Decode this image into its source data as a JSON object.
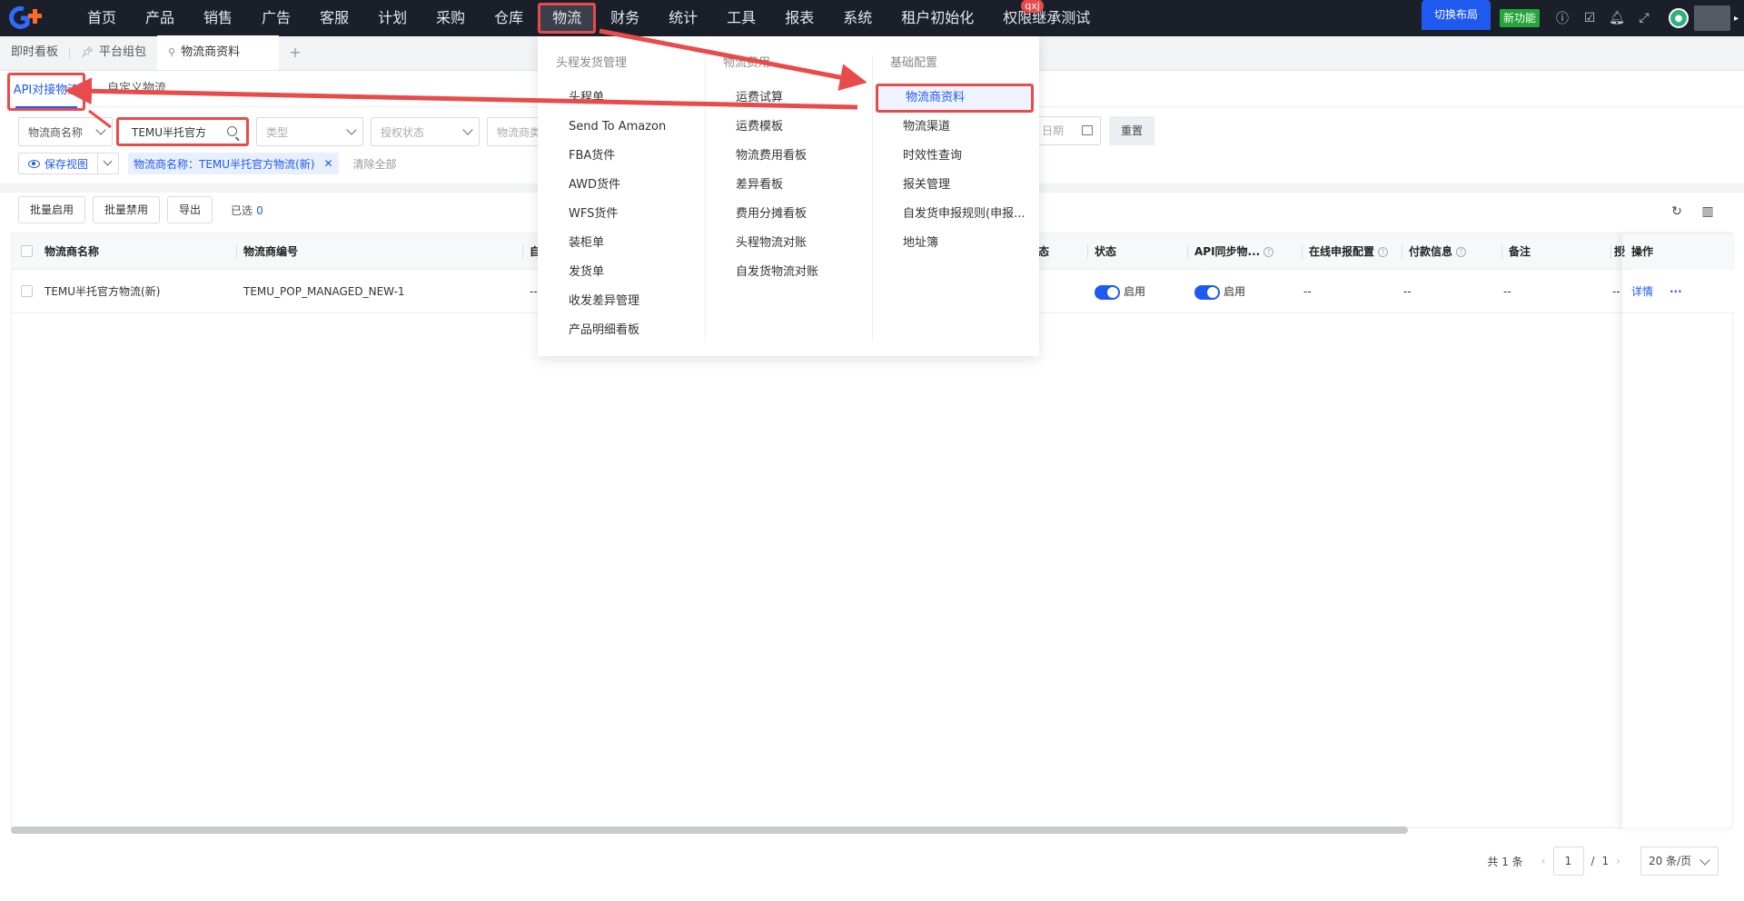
{
  "topnav": {
    "items": [
      "首页",
      "产品",
      "销售",
      "广告",
      "客服",
      "计划",
      "采购",
      "仓库",
      "物流",
      "财务",
      "统计",
      "工具",
      "报表",
      "系统",
      "租户初始化",
      "权限继承测试"
    ],
    "active_index": 8,
    "badge": "qxj",
    "switch_layout": "切换布局",
    "new_feature": "新功能"
  },
  "tabs": {
    "items": [
      "即时看板",
      "平台组包",
      "物流商资料"
    ],
    "add": "+"
  },
  "subtabs": {
    "api": "API对接物流",
    "custom": "自定义物流"
  },
  "filters": {
    "name_select": "物流商名称",
    "search_value": "TEMU半托官方",
    "type_placeholder": "类型",
    "auth_placeholder": "授权状态",
    "carrier_type_placeholder": "物流商类型",
    "date_placeholder": "日期",
    "reset": "重置"
  },
  "viewrow": {
    "save_view": "保存视图",
    "chip": "物流商名称：TEMU半托官方物流(新)",
    "clear_all": "清除全部"
  },
  "actions": {
    "batch_enable": "批量启用",
    "batch_disable": "批量禁用",
    "export": "导出",
    "selected_label": "已选",
    "selected_count": "0"
  },
  "table": {
    "headers": {
      "name": "物流商名称",
      "code": "物流商编号",
      "self": "自",
      "auth_status_tail": "态",
      "status": "状态",
      "api_sync": "API同步物...",
      "online_declare": "在线申报配置",
      "payment": "付款信息",
      "remark": "备注",
      "auth": "授",
      "ops": "操作"
    },
    "row": {
      "name": "TEMU半托官方物流(新)",
      "code": "TEMU_POP_MANAGED_NEW-1",
      "self": "--",
      "status": "启用",
      "api_sync": "启用",
      "online_declare": "--",
      "payment": "--",
      "remark": "--",
      "auth": "--",
      "detail": "详情",
      "more": "···"
    }
  },
  "pager": {
    "total": "共 1 条",
    "page": "1",
    "pages": "1",
    "slash": "/",
    "size": "20 条/页"
  },
  "menu": {
    "col1": {
      "title": "头程发货管理",
      "items": [
        "头程单",
        "Send To Amazon",
        "FBA货件",
        "AWD货件",
        "WFS货件",
        "装柜单",
        "发货单",
        "收发差异管理",
        "产品明细看板"
      ]
    },
    "col2": {
      "title": "物流费用",
      "items": [
        "运费试算",
        "运费模板",
        "物流费用看板",
        "差异看板",
        "费用分摊看板",
        "头程物流对账",
        "自发货物流对账"
      ]
    },
    "col3": {
      "title": "基础配置",
      "items": [
        "物流商资料",
        "物流渠道",
        "时效性查询",
        "报关管理",
        "自发货申报规则(申报...",
        "地址簿"
      ]
    }
  },
  "colors": {
    "accent": "#1f5af0",
    "highlight": "#e94b4b",
    "nav_bg": "#1b1f2a",
    "toggle_on": "#1f5af0"
  }
}
